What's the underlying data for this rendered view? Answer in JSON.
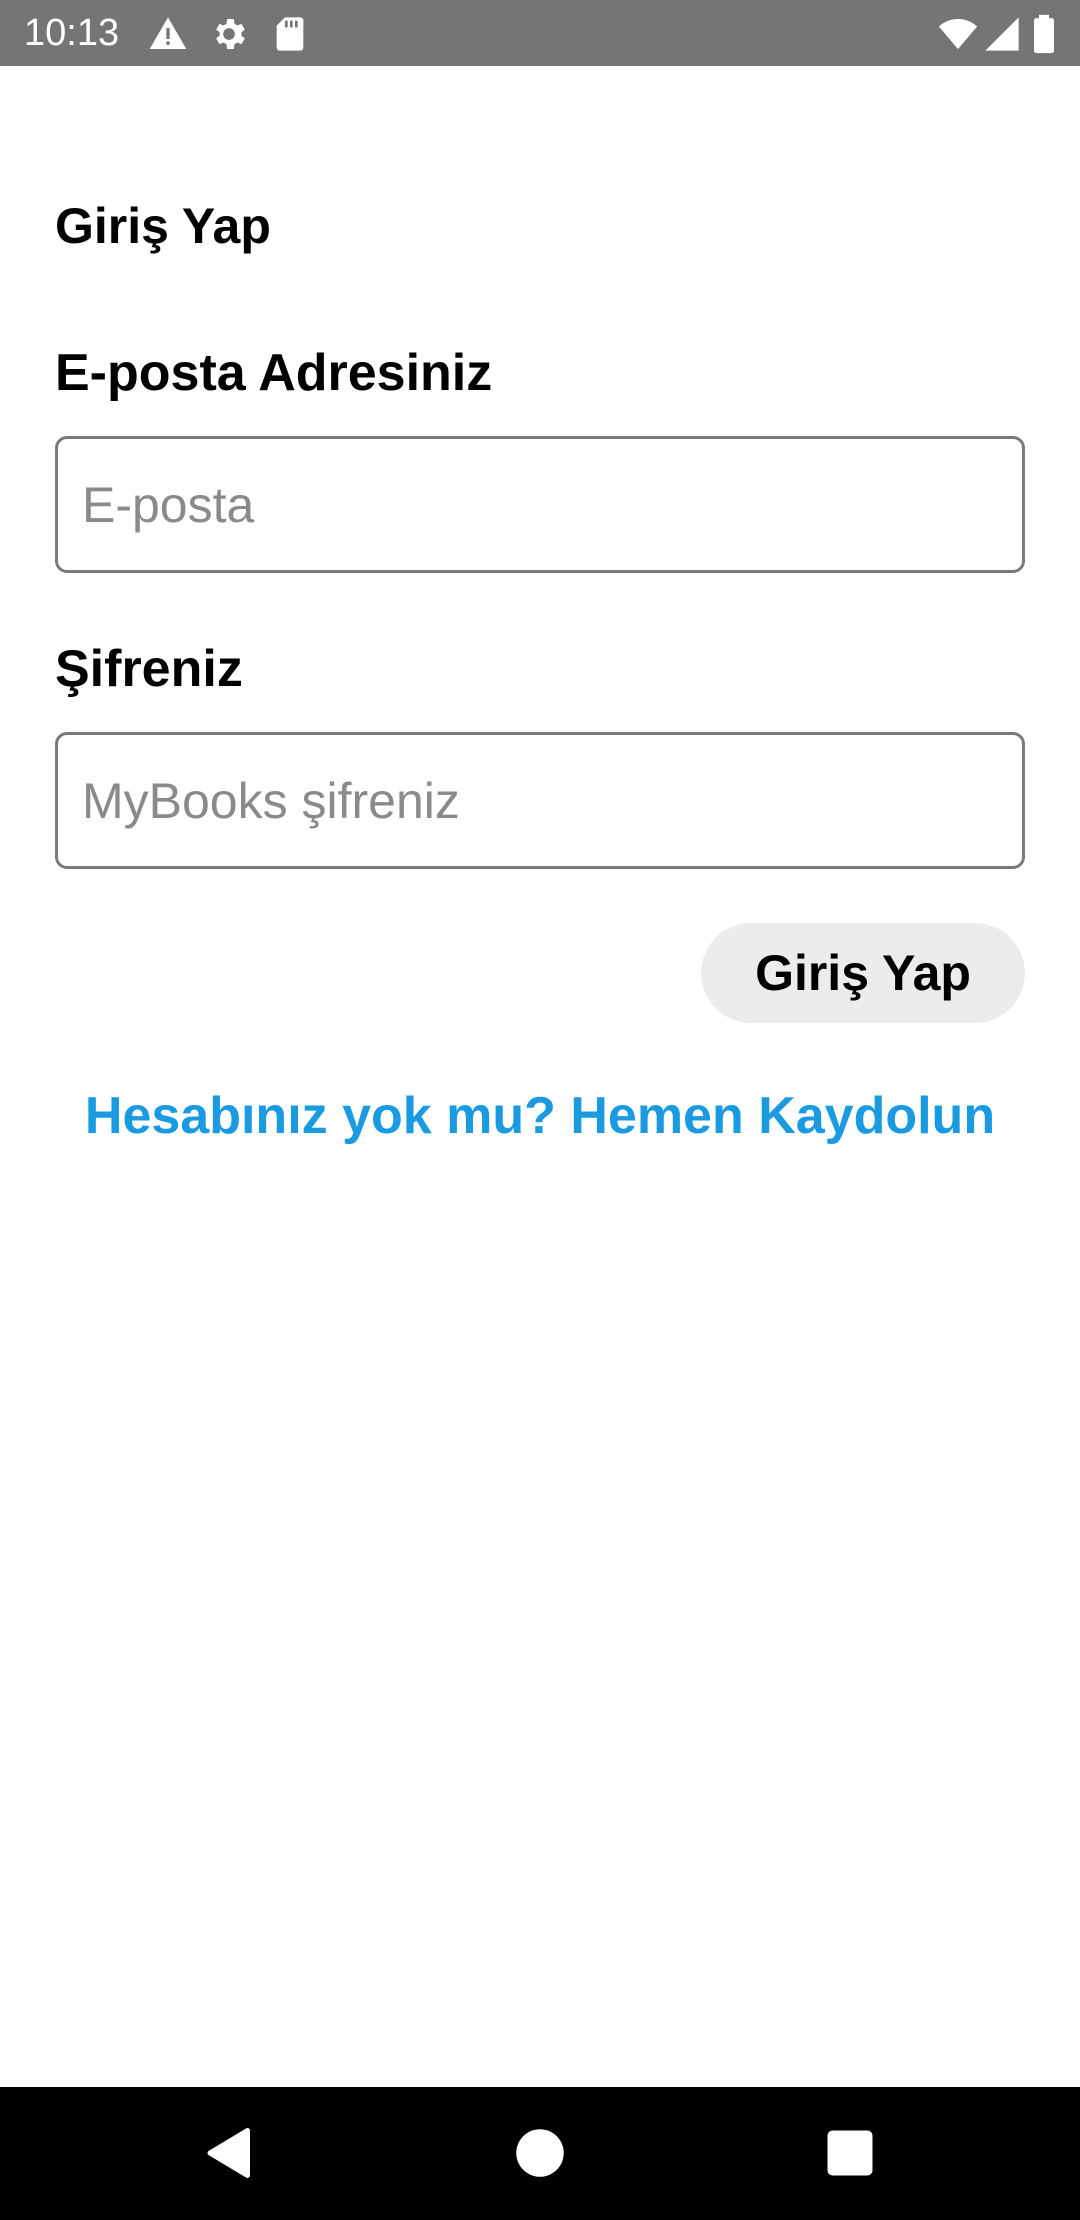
{
  "status_bar": {
    "time": "10:13",
    "left_icons": [
      "warning-icon",
      "settings-icon",
      "sd-card-icon"
    ],
    "right_icons": [
      "wifi-icon",
      "signal-icon",
      "battery-icon"
    ]
  },
  "login": {
    "title": "Giriş Yap",
    "email_label": "E-posta Adresiniz",
    "email_placeholder": "E-posta",
    "email_value": "",
    "password_label": "Şifreniz",
    "password_placeholder": "MyBooks şifreniz",
    "password_value": "",
    "submit_label": "Giriş Yap",
    "register_link": "Hesabınız yok mu? Hemen Kaydolun"
  },
  "colors": {
    "status_bar": "#757575",
    "link": "#1a9ae0",
    "button_bg": "#ececec",
    "input_border": "#7a7a7a",
    "nav_bar": "#000000"
  },
  "nav_bar": {
    "buttons": [
      "back-icon",
      "home-icon",
      "recents-icon"
    ]
  }
}
